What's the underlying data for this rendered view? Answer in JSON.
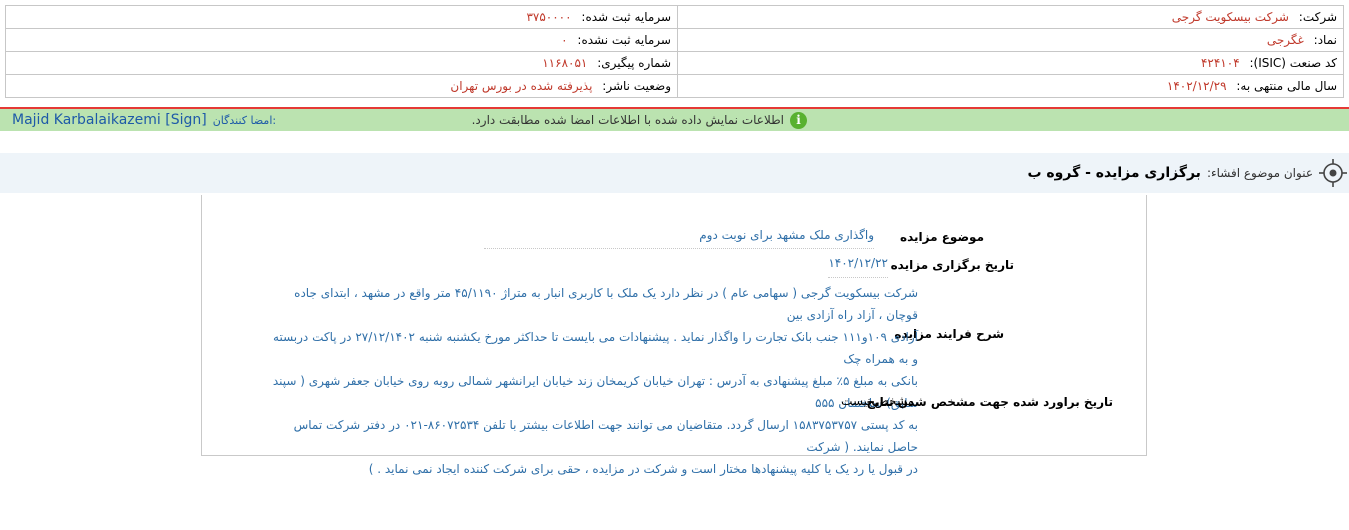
{
  "company_info": {
    "company_label": "شرکت:",
    "company_value": "شرکت بیسکویت گرجی",
    "registered_capital_label": "سرمایه ثبت شده:",
    "registered_capital_value": "۳۷۵۰۰۰۰",
    "symbol_label": "نماد:",
    "symbol_value": "غگرجی",
    "unregistered_capital_label": "سرمایه ثبت نشده:",
    "unregistered_capital_value": "۰",
    "isic_label": "کد صنعت (ISIC):",
    "isic_value": "۴۲۴۱۰۴",
    "tracking_label": "شماره پیگیری:",
    "tracking_value": "۱۱۶۸۰۵۱",
    "fiscal_year_label": "سال مالی منتهی به:",
    "fiscal_year_value": "۱۴۰۲/۱۲/۲۹",
    "publisher_status_label": "وضعیت ناشر:",
    "publisher_status_value": "پذیرفته شده در بورس تهران"
  },
  "signature": {
    "message": "اطلاعات نمایش داده شده با اطلاعات امضا شده مطابقت دارد.",
    "signers_label": "امضا کنندگان:",
    "signer_name": "Majid Karbalaikazemi [Sign]"
  },
  "subject": {
    "label": "عنوان موضوع افشاء:",
    "title": "برگزاری مزایده - گروه ب"
  },
  "auction": {
    "topic_label": "موضوع مزایده",
    "topic_value": "واگذاری ملک مشهد برای نوبت دوم",
    "date_label": "تاریخ برگزاری مزایده",
    "date_value": "۱۴۰۲/۱۲/۲۲",
    "process_label": "شرح فرایند مزایده",
    "process_lines": [
      "شرکت بیسکویت گرجی ( سهامی عام ) در نظر دارد یک ملک با کاربری انبار به متراژ ۴۵/۱۱۹۰ متر واقع در مشهد ، ابتدای جاده قوچان ، آزاد راه آزادی بین",
      "آزادی ۱۰۹و۱۱۱ جنب بانک تجارت را واگذار نماید . پیشنهادات می بایست تا حداکثر مورخ یکشنبه شنبه ۲۷/۱۲/۱۴۰۲ در پاکت دربسته و به همراه چک",
      "بانکی به مبلغ ۵٪ مبلغ پیشنهادی به آدرس : تهران خیابان کریمخان زند خیابان ایرانشهر شمالی روبه روی خیابان جعفر شهری ( سپند سابق) ساختمان ۵۵۵",
      "به کد پستی ۱۵۸۳۷۵۳۷۵۷ ارسال گردد. متقاضیان می توانند جهت اطلاعات بیشتر با تلفن ۸۶۰۷۲۵۳۴-۰۲۱ در دفتر شرکت تماس حاصل نمایند. ( شرکت",
      "در قبول یا رد یک یا کلیه پیشنهادها مختار است و شرکت در مزایده ، حقی برای شرکت کننده ایجاد نمی نماید . )"
    ],
    "result_date_label": "تاریخ براورد شده جهت مشخص شدن نتایج",
    "result_date_value": "مشخص نیست"
  },
  "colors": {
    "value_red": "#c0392b",
    "link_blue": "#1e5aa8",
    "sign_green": "#bbe3b0",
    "info_green": "#58b130"
  }
}
